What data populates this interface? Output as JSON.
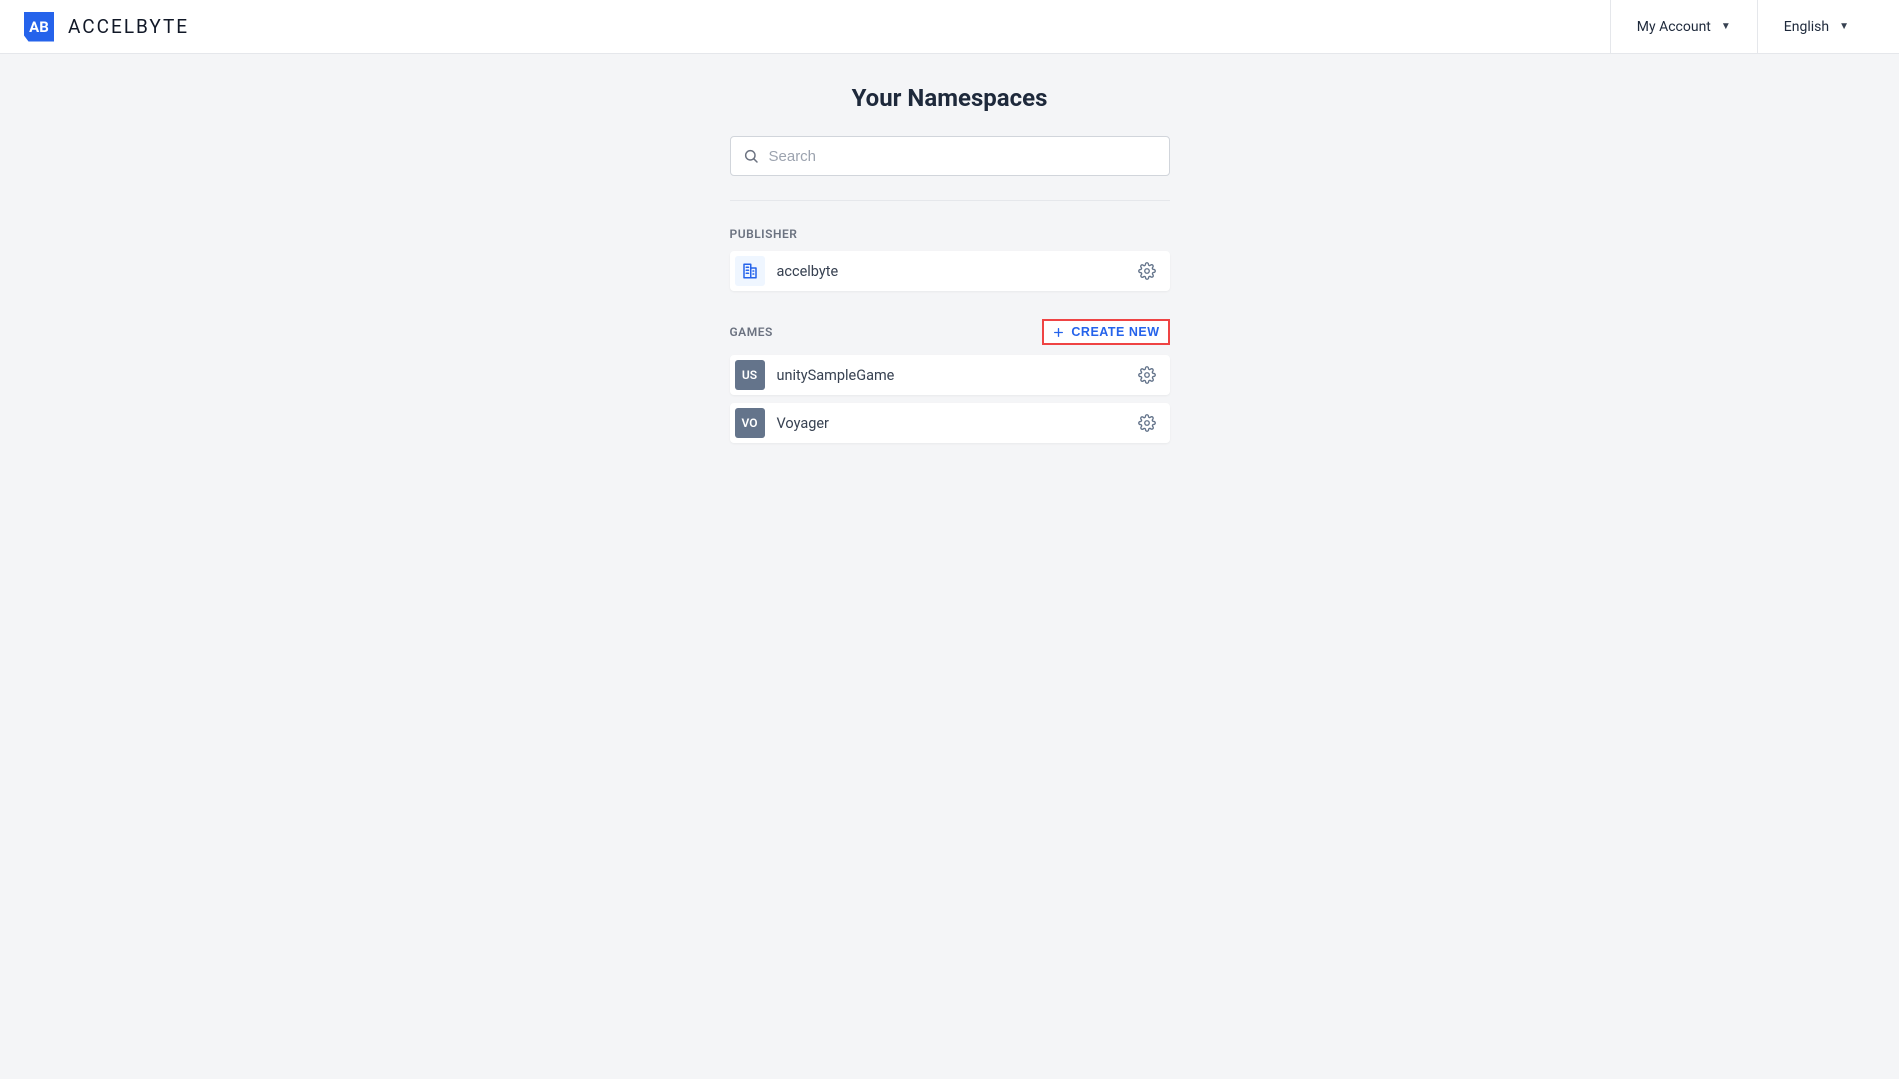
{
  "brand": {
    "mark": "AB",
    "name": "ACCELBYTE"
  },
  "header": {
    "account": "My Account",
    "language": "English"
  },
  "page": {
    "title": "Your Namespaces",
    "search_placeholder": "Search"
  },
  "sections": {
    "publisher": {
      "label": "PUBLISHER",
      "items": [
        {
          "name": "accelbyte"
        }
      ]
    },
    "games": {
      "label": "GAMES",
      "create_label": "CREATE NEW",
      "items": [
        {
          "abbr": "US",
          "name": "unitySampleGame"
        },
        {
          "abbr": "VO",
          "name": "Voyager"
        }
      ]
    }
  }
}
